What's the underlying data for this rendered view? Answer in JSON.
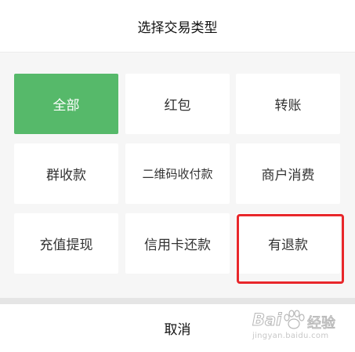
{
  "header": {
    "title": "选择交易类型"
  },
  "options": [
    {
      "label": "全部",
      "selected": true
    },
    {
      "label": "红包"
    },
    {
      "label": "转账"
    },
    {
      "label": "群收款"
    },
    {
      "label": "二维码收付款"
    },
    {
      "label": "商户消费"
    },
    {
      "label": "充值提现"
    },
    {
      "label": "信用卡还款"
    },
    {
      "label": "有退款"
    }
  ],
  "footer": {
    "cancel_label": "取消"
  },
  "watermark": {
    "brand": "Bai",
    "name": "经验",
    "url": "jingyan.baidu.com"
  },
  "colors": {
    "selected": "#56b96a",
    "highlight": "#e8272b"
  }
}
